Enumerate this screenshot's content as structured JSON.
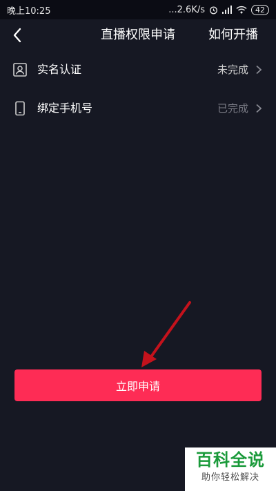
{
  "status_bar": {
    "time": "晚上10:25",
    "net_speed": "...2.6K/s",
    "battery": "42"
  },
  "header": {
    "title": "直播权限申请",
    "help_link": "如何开播"
  },
  "requirements": [
    {
      "label": "实名认证",
      "status": "未完成",
      "status_color": "#cfcfcf"
    },
    {
      "label": "绑定手机号",
      "status": "已完成",
      "status_color": "#7a7b85"
    }
  ],
  "apply_button": {
    "label": "立即申请",
    "color": "#fe2c55"
  },
  "watermark": {
    "main": "百科全说",
    "sub": "助你轻松解决"
  },
  "colors": {
    "background": "#161823",
    "accent": "#fe2c55",
    "annotation_arrow": "#c4121c"
  }
}
